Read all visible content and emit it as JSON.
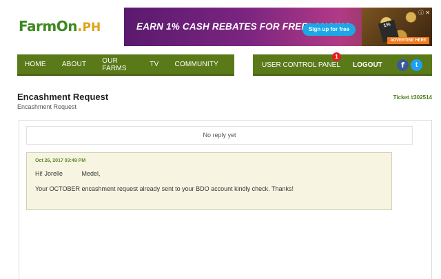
{
  "logo": {
    "main": "FarmOn",
    "dot": ".",
    "suffix": "PH"
  },
  "ad": {
    "headline": "EARN 1% CASH REBATES FOR FREELANCING",
    "button": "Sign up for free",
    "card_text": "1%",
    "advertise": "ADVERTISE HERE",
    "close": "ⓘ ✕"
  },
  "nav": {
    "left": [
      {
        "label": "HOME"
      },
      {
        "label": "ABOUT"
      },
      {
        "label": "OUR FARMS"
      },
      {
        "label": "TV"
      },
      {
        "label": "COMMUNITY"
      }
    ],
    "user_control_panel": "USER CONTROL PANEL",
    "badge": "1",
    "logout": "LOGOUT",
    "facebook": "f",
    "twitter": "t"
  },
  "page": {
    "title": "Encashment Request",
    "subtitle": "Encashment Request",
    "ticket": "Ticket #302514"
  },
  "thread": {
    "no_reply": "No reply yet",
    "message": {
      "date": "Oct 26, 2017 03:49 PM",
      "greeting": "Hi! Jorelle           Medel,",
      "body": "Your OCTOBER encashment request already sent to your BDO account kindly check. Thanks!"
    }
  },
  "colors": {
    "nav_green": "#5a7a1a",
    "logo_green": "#3d8a1f",
    "logo_orange": "#e0a11b",
    "message_bg": "#f7f5e2",
    "badge_red": "#e02020"
  }
}
